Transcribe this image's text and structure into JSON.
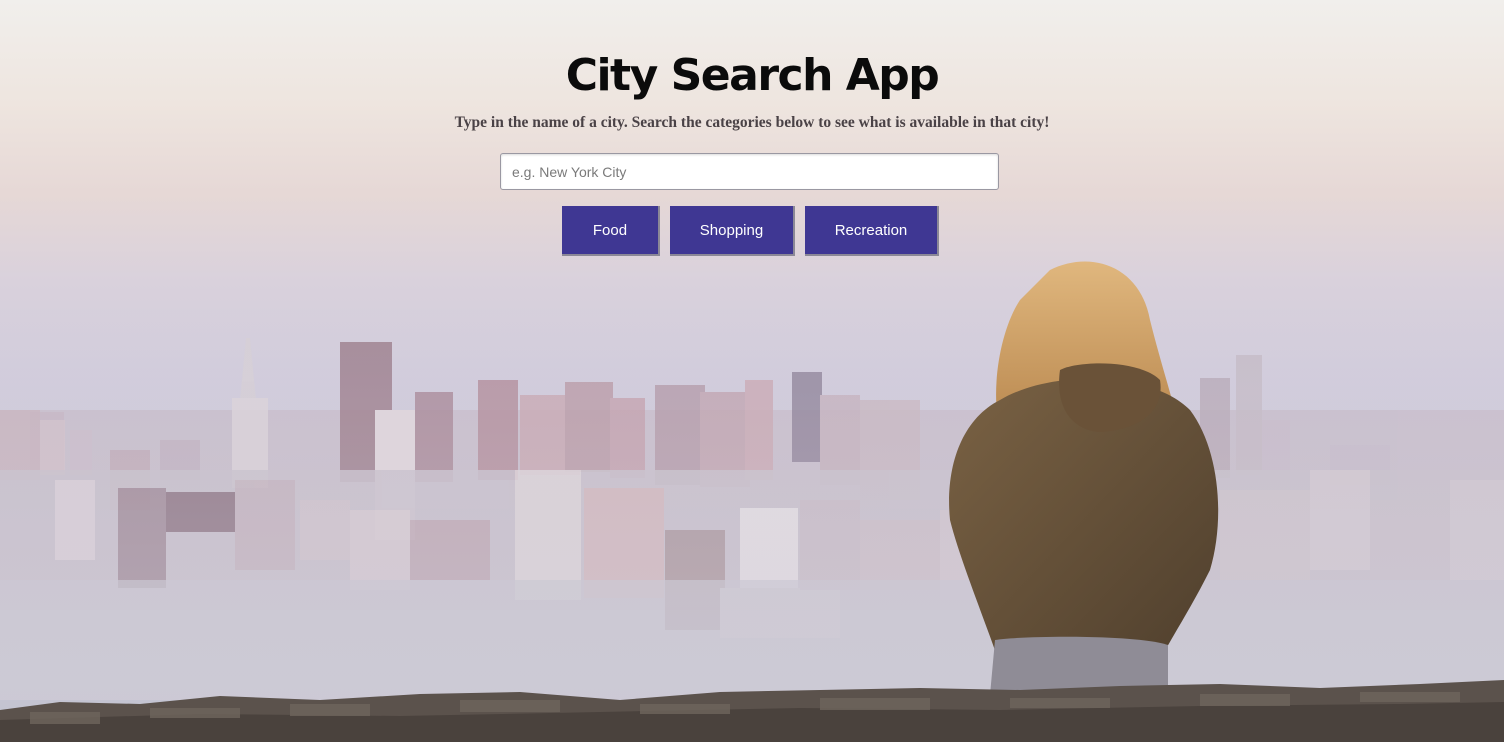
{
  "header": {
    "title": "City Search App",
    "subtitle": "Type in the name of a city. Search the categories below to see what is available in that city!"
  },
  "search": {
    "placeholder": "e.g. New York City",
    "value": ""
  },
  "categories": [
    {
      "label": "Food"
    },
    {
      "label": "Shopping"
    },
    {
      "label": "Recreation"
    }
  ],
  "colors": {
    "button": "#3f3793",
    "title": "#0b0b0b",
    "subtitle": "#4a4246"
  },
  "background": {
    "description_icon": "city-skyline-photo"
  }
}
